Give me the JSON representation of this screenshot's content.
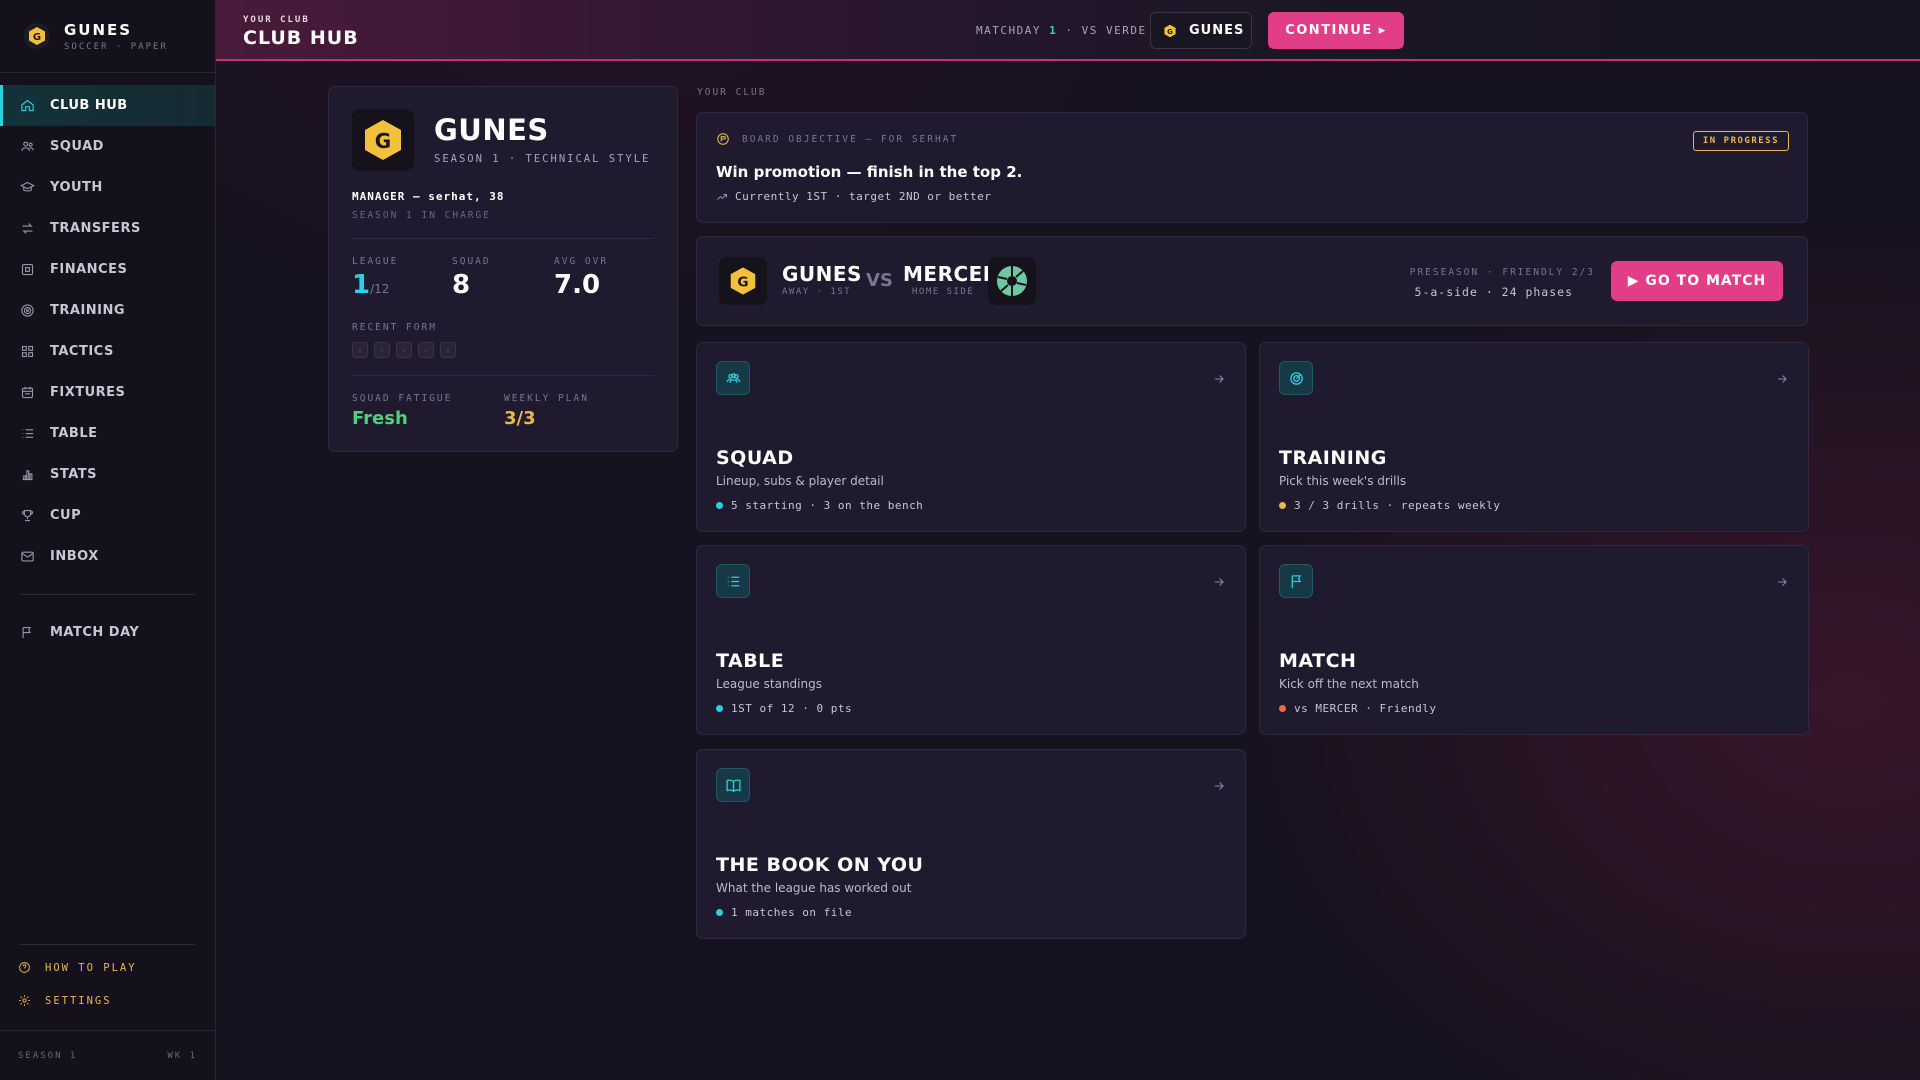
{
  "brand": {
    "name": "GUNES",
    "sub": "SOCCER · PAPER",
    "crest_letter": "G"
  },
  "sidebar": {
    "items": [
      {
        "label": "CLUB HUB",
        "icon": "home-icon",
        "active": true
      },
      {
        "label": "SQUAD",
        "icon": "users-icon"
      },
      {
        "label": "YOUTH",
        "icon": "graduation-cap-icon"
      },
      {
        "label": "TRANSFERS",
        "icon": "transfer-arrows-icon"
      },
      {
        "label": "FINANCES",
        "icon": "wallet-icon"
      },
      {
        "label": "TRAINING",
        "icon": "target-icon"
      },
      {
        "label": "TACTICS",
        "icon": "grid-icon"
      },
      {
        "label": "FIXTURES",
        "icon": "calendar-icon"
      },
      {
        "label": "TABLE",
        "icon": "list-icon"
      },
      {
        "label": "STATS",
        "icon": "bar-chart-icon"
      },
      {
        "label": "CUP",
        "icon": "trophy-icon"
      },
      {
        "label": "INBOX",
        "icon": "mail-icon"
      }
    ],
    "match_day": "MATCH DAY",
    "how_to_play": "HOW TO PLAY",
    "settings": "SETTINGS",
    "footer_season": "SEASON 1",
    "footer_week": "WK 1"
  },
  "topbar": {
    "crumb_small": "YOUR CLUB",
    "crumb_big": "CLUB HUB",
    "matchday_prefix": "MATCHDAY",
    "matchday_num": "1",
    "matchday_suffix": "· VS VERDE",
    "club_pill": "GUNES",
    "continue": "CONTINUE ▸"
  },
  "club": {
    "name": "GUNES",
    "sub": "SEASON 1 · TECHNICAL STYLE",
    "manager": "MANAGER — serhat, 38",
    "manager_sub": "SEASON 1 IN CHARGE",
    "league_label": "LEAGUE",
    "league_pos": "1",
    "league_of": "/12",
    "squad_label": "SQUAD",
    "squad_val": "8",
    "ovr_label": "AVG OVR",
    "ovr_val": "7.0",
    "form_label": "RECENT FORM",
    "form": [
      "-",
      "-",
      "-",
      "-",
      "-"
    ],
    "fatigue_label": "SQUAD FATIGUE",
    "fatigue_val": "Fresh",
    "plan_label": "WEEKLY PLAN",
    "plan_val": "3/3",
    "colors": {
      "fresh": "#4fd07a",
      "plan": "#e8b84a",
      "crest": "#f2c03a"
    }
  },
  "section_label": "YOUR CLUB",
  "objective": {
    "top": "BOARD OBJECTIVE — FOR SERHAT",
    "main": "Win promotion — finish in the top 2.",
    "sub": "Currently 1ST · target 2ND or better",
    "badge": "IN PROGRESS"
  },
  "fixture": {
    "home_name": "GUNES",
    "home_sub": "AWAY · 1ST",
    "vs": "VS",
    "away_name": "MERCER",
    "away_sub": "HOME SIDE",
    "meta1": "PRESEASON · FRIENDLY 2/3",
    "meta2": "5-a-side · 24 phases",
    "go": "▶ GO TO MATCH"
  },
  "tiles": [
    {
      "title": "SQUAD",
      "sub": "Lineup, subs & player detail",
      "meta": "5 starting · 3 on the bench",
      "dot": "#2ad1e0",
      "icon": "users-icon"
    },
    {
      "title": "TRAINING",
      "sub": "Pick this week's drills",
      "meta": "3 / 3 drills · repeats weekly",
      "dot": "#e8b84a",
      "icon": "target-icon"
    },
    {
      "title": "TABLE",
      "sub": "League standings",
      "meta": "1ST of 12 · 0 pts",
      "dot": "#2ad1e0",
      "icon": "list-icon"
    },
    {
      "title": "MATCH",
      "sub": "Kick off the next match",
      "meta": "vs MERCER · Friendly",
      "dot": "#f06a4a",
      "icon": "flag-icon"
    },
    {
      "title": "THE BOOK ON YOU",
      "sub": "What the league has worked out",
      "meta": "1 matches on file",
      "dot": "#2ad1e0",
      "icon": "book-icon"
    }
  ]
}
